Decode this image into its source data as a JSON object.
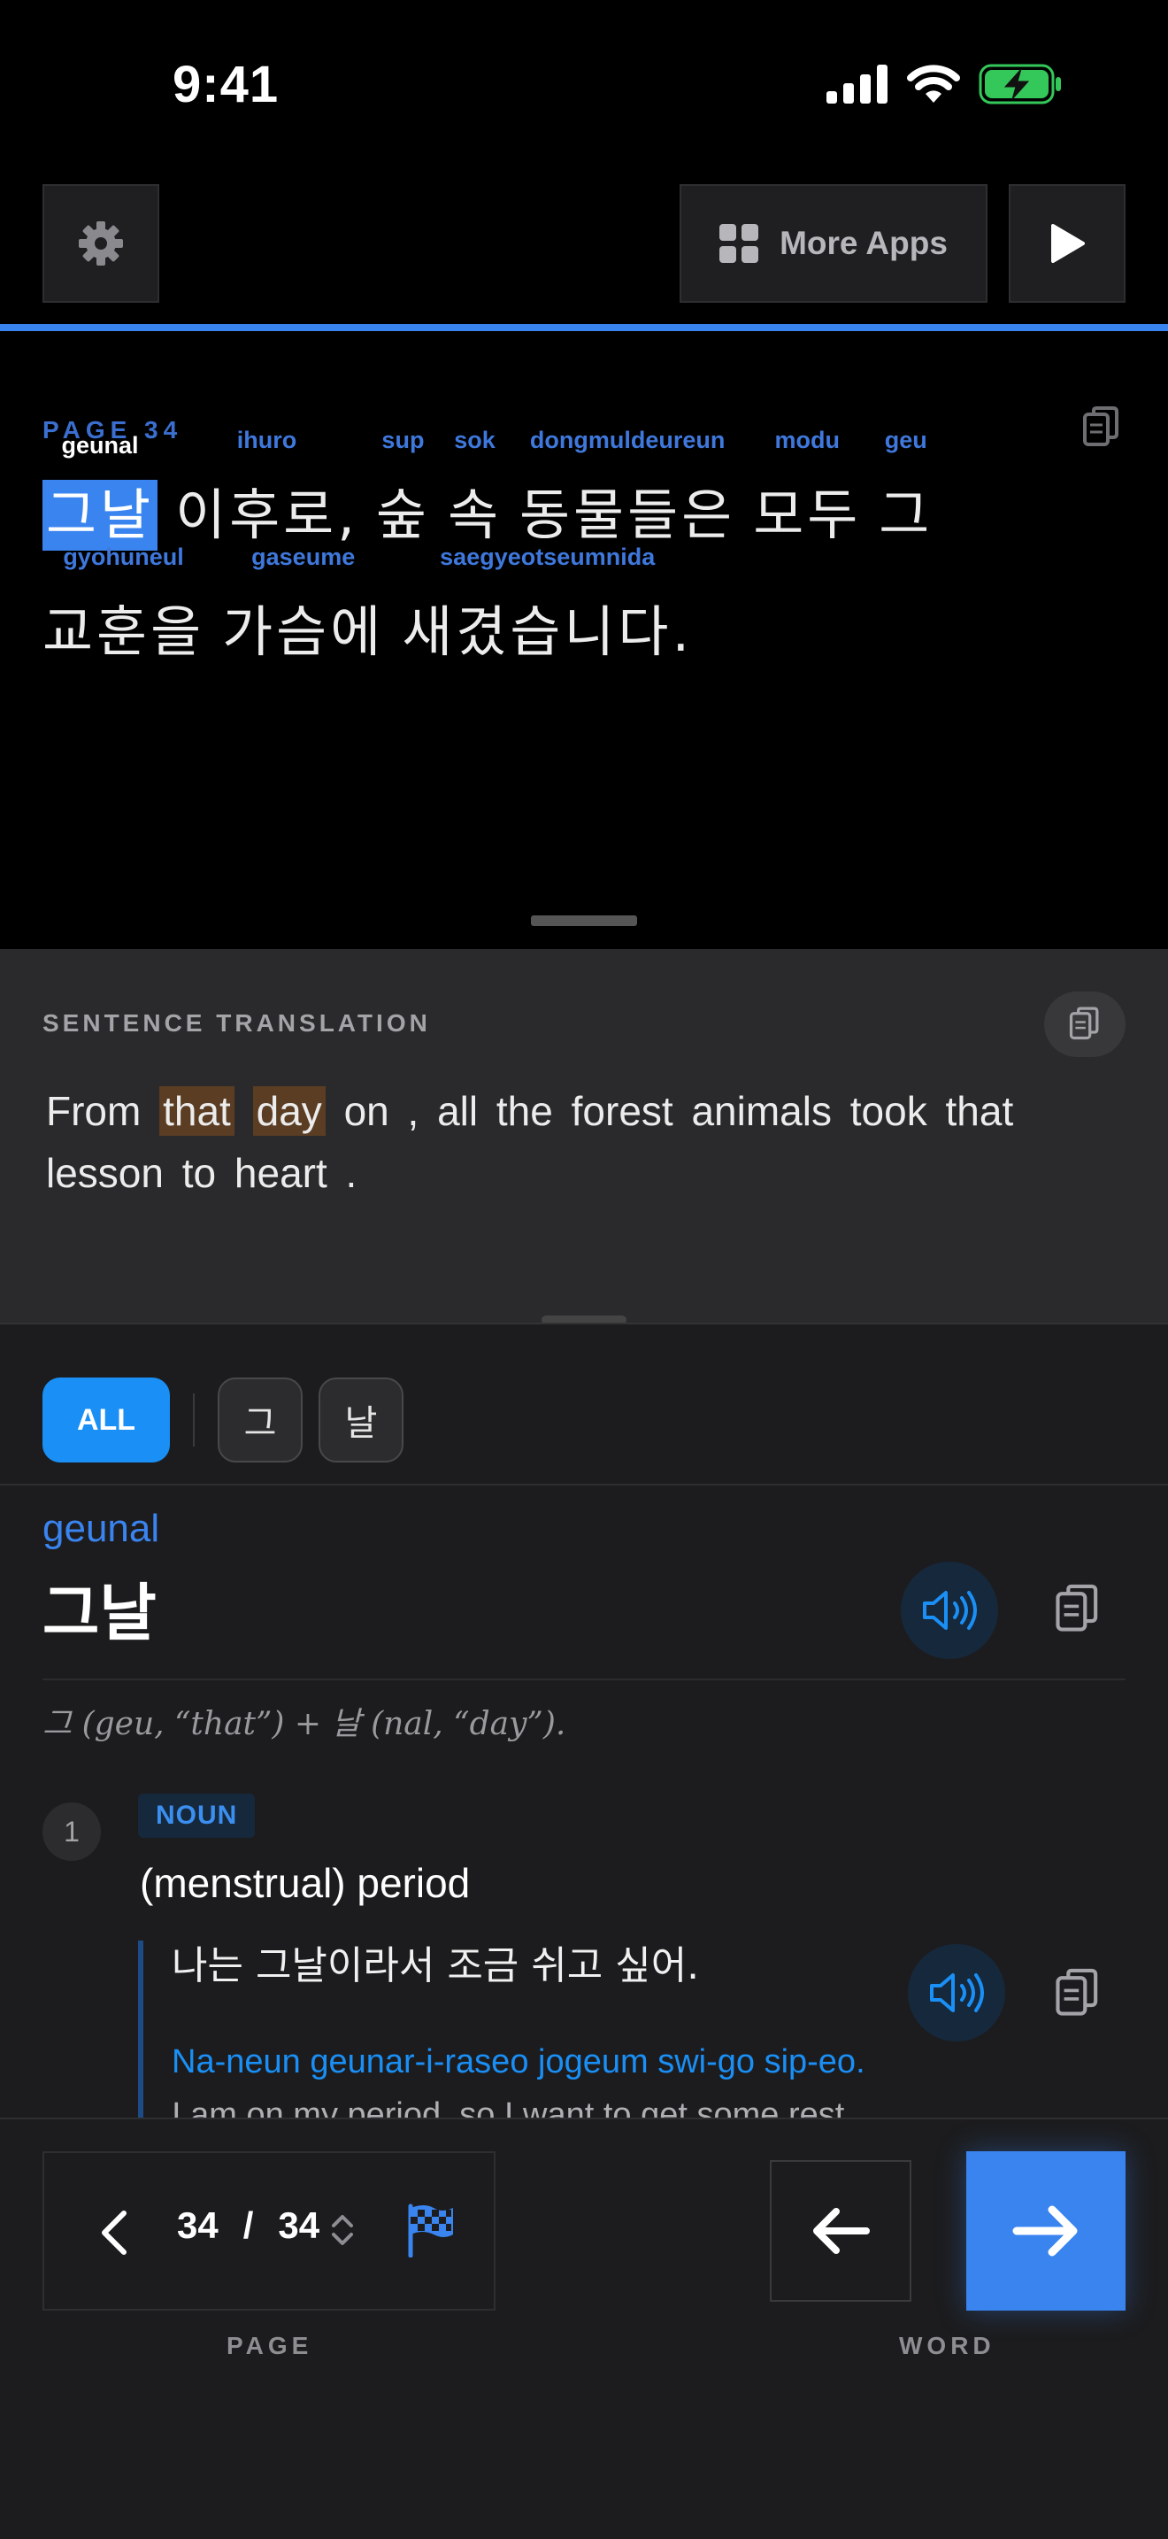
{
  "status": {
    "time": "9:41"
  },
  "toolbar": {
    "more_apps_label": "More Apps"
  },
  "reader": {
    "page_label": "PAGE  34",
    "line1": [
      {
        "roman": "geunal",
        "kor": "그날"
      },
      {
        "roman": "ihuro",
        "kor": "이후로,"
      },
      {
        "roman": "sup",
        "kor": "숲"
      },
      {
        "roman": "sok",
        "kor": "속"
      },
      {
        "roman": "dongmuldeureun",
        "kor": "동물들은"
      },
      {
        "roman": "modu",
        "kor": "모두"
      },
      {
        "roman": "geu",
        "kor": "그"
      }
    ],
    "line2": [
      {
        "roman": "gyohuneul",
        "kor": "교훈을"
      },
      {
        "roman": "gaseume",
        "kor": "가슴에"
      },
      {
        "roman": "saegyeotseumnida",
        "kor": "새겼습니다."
      }
    ]
  },
  "translation": {
    "label": "SENTENCE TRANSLATION",
    "words": [
      "From",
      "that",
      "day",
      "on",
      ",",
      "all",
      "the",
      "forest",
      "animals",
      "took",
      "that",
      "lesson",
      "to",
      "heart",
      "."
    ],
    "highlighted": [
      1,
      2
    ]
  },
  "dictionary": {
    "filter_all": "ALL",
    "filters": [
      "그",
      "날"
    ],
    "romanization": "geunal",
    "headword": "그날",
    "etymology": "그 (geu, “that”) + 날 (nal, “day”).",
    "sense_number": "1",
    "pos": "NOUN",
    "definition": "(menstrual) period",
    "example_korean": "나는 그날이라서 조금 쉬고 싶어.",
    "example_romanized": "Na-neun geunar-i-raseo jogeum swi-go sip-eo.",
    "example_english": "I am on my period, so I want to get some rest."
  },
  "bottom": {
    "current_page": "34",
    "separator": "/",
    "total_pages": "34",
    "page_label": "PAGE",
    "word_label": "WORD"
  },
  "colors": {
    "accent": "#3a84f0",
    "chip_active": "#1a8ff5",
    "highlight": "#5a3d23",
    "battery": "#34c759"
  }
}
